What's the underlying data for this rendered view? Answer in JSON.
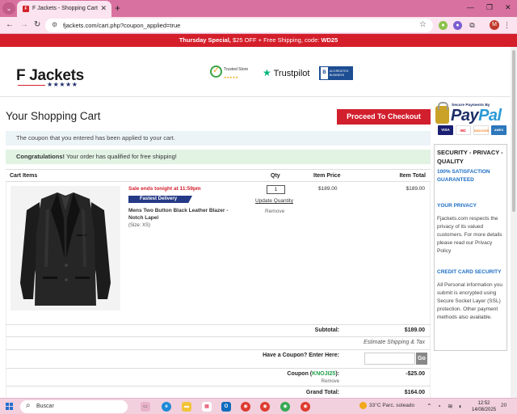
{
  "browser": {
    "tab_title": "F Jackets - Shopping Cart",
    "url": "fjackets.com/cart.php?coupon_applied=true",
    "profile_initial": "M"
  },
  "promo": {
    "bold": "Thursday Special,",
    "middle": " $25 OFF + Free Shipping, code: ",
    "code": "WD25"
  },
  "header": {
    "logo": "F Jackets",
    "logo_stars": "★★★★★",
    "trusted_line1": "Trusted Store",
    "trusted_stars": "★★★★★",
    "trustpilot": "Trustpilot",
    "bbb_line1": "ACCREDITED",
    "bbb_line2": "BUSINESS"
  },
  "cart": {
    "title": "Your Shopping Cart",
    "checkout_label": "Proceed To Checkout",
    "alert_coupon": "The coupon that you entered has been applied to your cart.",
    "alert_ok_bold": "Congratulations!",
    "alert_ok_text": " Your order has qualified for free shipping!",
    "headers": {
      "items": "Cart Items",
      "qty": "Qty",
      "price": "Item Price",
      "total": "Item Total"
    },
    "item": {
      "sale": "Sale ends tonight at 11:59pm",
      "badge": "Fastest Delivery",
      "name": "Mens Two Button Black Leather Blazer - Notch Lapel",
      "size": "(Size: XS)",
      "qty": "1",
      "update": "Update Quantity",
      "remove": "Remove",
      "price": "$189.00",
      "total": "$189.00"
    },
    "subtotal_label": "Subtotal:",
    "subtotal": "$189.00",
    "estimate": "Estimate Shipping & Tax",
    "coupon_prompt": "Have a Coupon? Enter Here:",
    "go": "Go",
    "coupon_label_pre": "Coupon (",
    "coupon_code": "KNOJI25",
    "coupon_label_post": "):",
    "coupon_remove": "Remove",
    "coupon_value": "-$25.00",
    "grand_label": "Grand Total:",
    "grand_total": "$164.00"
  },
  "sidebar": {
    "secure_by": "Secure Payments By",
    "paypal_a": "Pay",
    "paypal_b": "Pal",
    "card1": "VISA",
    "card2": "MC",
    "card3": "DISCOVER",
    "card4": "AMEX",
    "heading": "SECURITY - PRIVACY - QUALITY",
    "satisfaction": "100% SATISFACTION GUARANTEED",
    "privacy_h": "YOUR PRIVACY",
    "privacy_p": "Fjackets.com respects the privacy of its valued customers. For more details please read our Privacy Policy",
    "cc_h": "CREDIT CARD SECURITY",
    "cc_p": "All Personal information you submit is encrypted using Secure Socket Layer (SSL) protection. Other payment methods also available."
  },
  "taskbar": {
    "search": "Buscar",
    "weather": "33°C  Parc. soleado",
    "time": "12:52",
    "date": "14/08/2025",
    "notif": "20"
  }
}
